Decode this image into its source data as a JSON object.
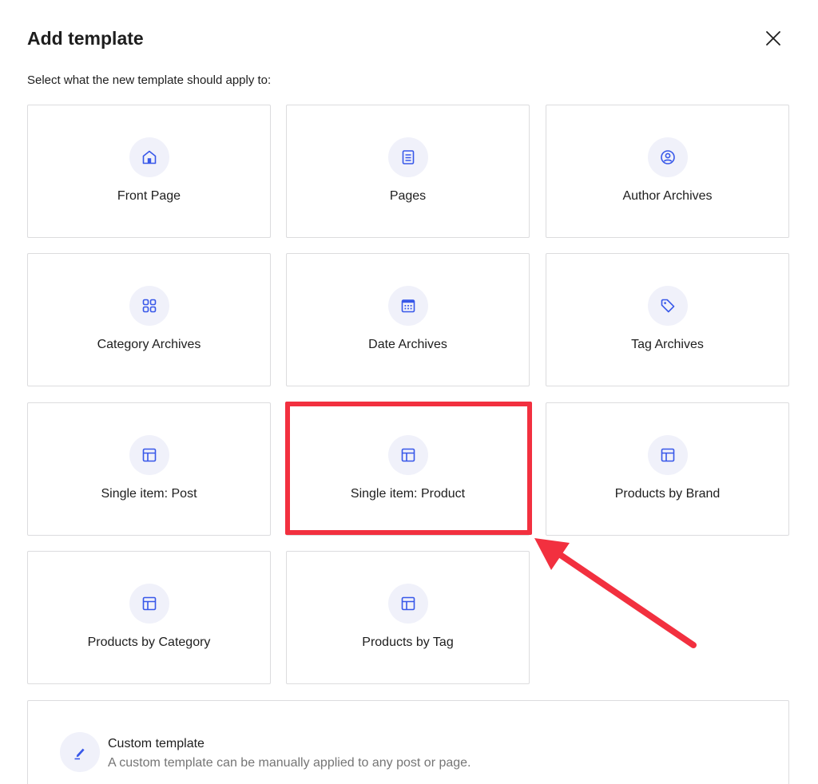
{
  "modal": {
    "title": "Add template",
    "close_icon": "close-icon",
    "instructions": "Select what the new template should apply to:"
  },
  "accent_color": "#3858e9",
  "highlight_color": "#f2303f",
  "templates": [
    {
      "label": "Front Page",
      "icon": "home-icon"
    },
    {
      "label": "Pages",
      "icon": "page-icon"
    },
    {
      "label": "Author Archives",
      "icon": "user-circle-icon"
    },
    {
      "label": "Category Archives",
      "icon": "category-icon"
    },
    {
      "label": "Date Archives",
      "icon": "calendar-icon"
    },
    {
      "label": "Tag Archives",
      "icon": "tag-icon"
    },
    {
      "label": "Single item: Post",
      "icon": "layout-icon"
    },
    {
      "label": "Single item: Product",
      "icon": "layout-icon"
    },
    {
      "label": "Products by Brand",
      "icon": "layout-icon"
    },
    {
      "label": "Products by Category",
      "icon": "layout-icon"
    },
    {
      "label": "Products by Tag",
      "icon": "layout-icon"
    }
  ],
  "custom_template": {
    "title": "Custom template",
    "description": "A custom template can be manually applied to any post or page.",
    "icon": "pencil-icon"
  }
}
